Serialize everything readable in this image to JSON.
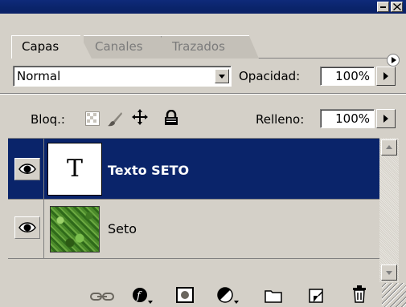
{
  "window": {
    "controls": [
      "minimize-icon",
      "close-icon"
    ]
  },
  "tabs": [
    {
      "label": "Capas",
      "active": true
    },
    {
      "label": "Canales",
      "active": false
    },
    {
      "label": "Trazados",
      "active": false
    }
  ],
  "blend": {
    "mode": "Normal",
    "opacity_label": "Opacidad:",
    "opacity_value": "100%"
  },
  "lock": {
    "label": "Bloq.:",
    "icons": [
      "lock-transparency-icon",
      "lock-brush-icon",
      "lock-move-icon",
      "lock-all-icon"
    ],
    "fill_label": "Relleno:",
    "fill_value": "100%"
  },
  "layers": [
    {
      "name": "Texto SETO",
      "type": "text",
      "thumb_glyph": "T",
      "visible": true,
      "selected": true
    },
    {
      "name": "Seto",
      "type": "image",
      "visible": true,
      "selected": false
    }
  ],
  "toolbar": {
    "icons": [
      "link-icon",
      "layer-style-icon",
      "add-mask-icon",
      "adjustment-layer-icon",
      "new-group-icon",
      "new-layer-icon",
      "trash-icon"
    ]
  },
  "colors": {
    "titlebar": "#0a246a",
    "selection": "#0a246a",
    "panel": "#d4d0c8"
  }
}
